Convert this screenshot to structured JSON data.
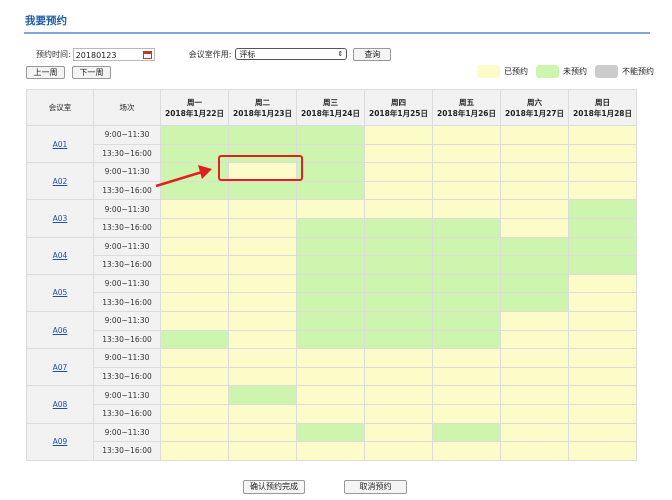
{
  "page": {
    "title": "我要预约"
  },
  "filters": {
    "date_label": "预约时间:",
    "date_value": "20180123",
    "usage_label": "会议室作用:",
    "usage_value": "评标",
    "search_label": "查询"
  },
  "week_nav": {
    "prev": "上一周",
    "next": "下一周"
  },
  "legend": [
    {
      "label": "已预约",
      "color": "#fcfcc8"
    },
    {
      "label": "未预约",
      "color": "#cdf5ad"
    },
    {
      "label": "不能预约",
      "color": "#cccccc"
    }
  ],
  "table": {
    "room_header": "会议室",
    "time_header": "场次",
    "days": [
      {
        "weekday": "周一",
        "date": "2018年1月22日"
      },
      {
        "weekday": "周二",
        "date": "2018年1月23日"
      },
      {
        "weekday": "周三",
        "date": "2018年1月24日"
      },
      {
        "weekday": "周四",
        "date": "2018年1月25日"
      },
      {
        "weekday": "周五",
        "date": "2018年1月26日"
      },
      {
        "weekday": "周六",
        "date": "2018年1月27日"
      },
      {
        "weekday": "周日",
        "date": "2018年1月28日"
      }
    ],
    "slots": [
      "9:00~11:30",
      "13:30~16:00"
    ],
    "rooms": [
      {
        "name": "A01",
        "status": [
          [
            "a",
            "a",
            "a",
            "b",
            "b",
            "b",
            "b"
          ],
          [
            "a",
            "a",
            "a",
            "b",
            "b",
            "b",
            "b"
          ]
        ]
      },
      {
        "name": "A02",
        "status": [
          [
            "a",
            "b",
            "a",
            "b",
            "b",
            "b",
            "b"
          ],
          [
            "a",
            "a",
            "a",
            "b",
            "b",
            "b",
            "b"
          ]
        ]
      },
      {
        "name": "A03",
        "status": [
          [
            "b",
            "b",
            "b",
            "b",
            "b",
            "b",
            "a"
          ],
          [
            "b",
            "b",
            "a",
            "a",
            "a",
            "b",
            "a"
          ]
        ]
      },
      {
        "name": "A04",
        "status": [
          [
            "b",
            "b",
            "a",
            "a",
            "a",
            "a",
            "a"
          ],
          [
            "b",
            "b",
            "a",
            "a",
            "a",
            "a",
            "a"
          ]
        ]
      },
      {
        "name": "A05",
        "status": [
          [
            "b",
            "b",
            "a",
            "a",
            "a",
            "a",
            "b"
          ],
          [
            "b",
            "b",
            "a",
            "a",
            "a",
            "a",
            "b"
          ]
        ]
      },
      {
        "name": "A06",
        "status": [
          [
            "b",
            "b",
            "a",
            "a",
            "a",
            "b",
            "b"
          ],
          [
            "a",
            "b",
            "a",
            "a",
            "a",
            "b",
            "b"
          ]
        ]
      },
      {
        "name": "A07",
        "status": [
          [
            "b",
            "b",
            "b",
            "b",
            "b",
            "b",
            "b"
          ],
          [
            "b",
            "b",
            "b",
            "b",
            "b",
            "b",
            "b"
          ]
        ]
      },
      {
        "name": "A08",
        "status": [
          [
            "b",
            "a",
            "b",
            "b",
            "b",
            "b",
            "b"
          ],
          [
            "b",
            "b",
            "b",
            "b",
            "b",
            "b",
            "b"
          ]
        ]
      },
      {
        "name": "A09",
        "status": [
          [
            "b",
            "b",
            "a",
            "b",
            "a",
            "b",
            "b"
          ],
          [
            "b",
            "b",
            "b",
            "b",
            "b",
            "b",
            "b"
          ]
        ]
      }
    ]
  },
  "actions": {
    "confirm": "确认预约完成",
    "cancel": "取消预约"
  }
}
